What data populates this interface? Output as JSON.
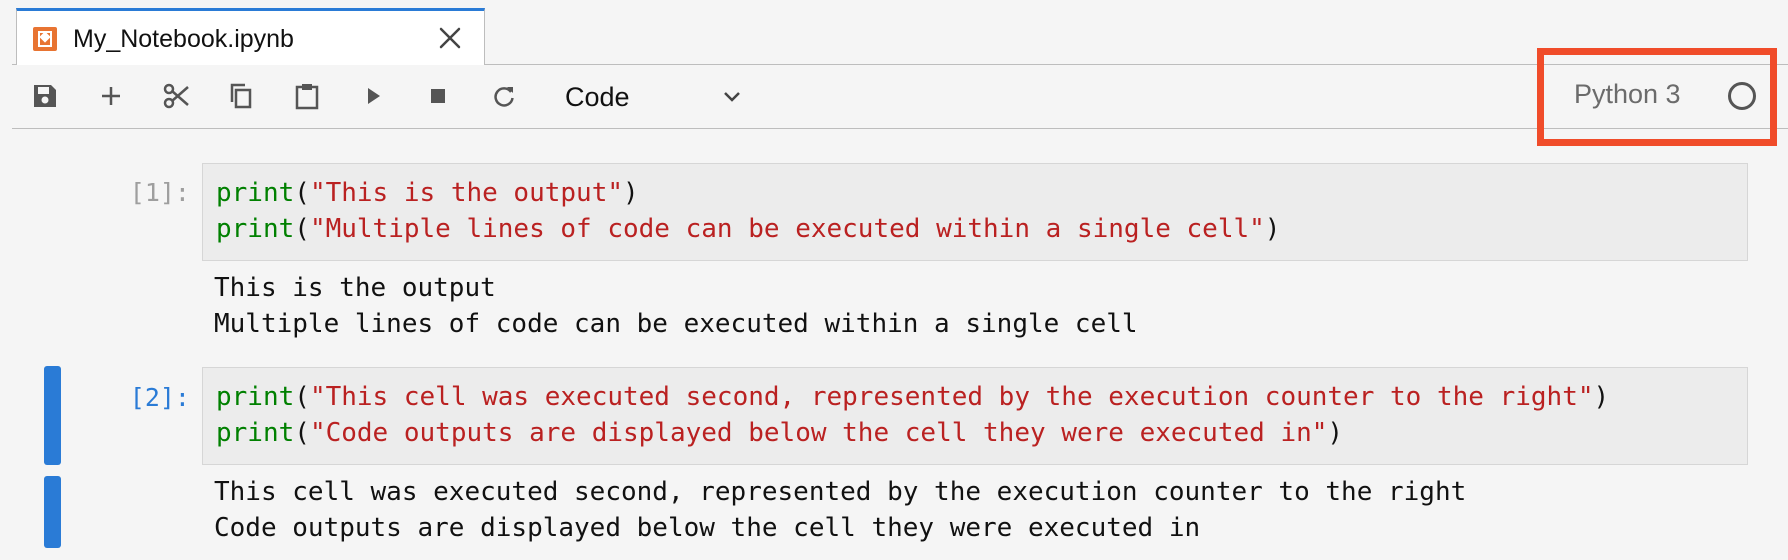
{
  "tab": {
    "title": "My_Notebook.ipynb"
  },
  "toolbar": {
    "cell_type": "Code",
    "buttons": [
      "save-icon",
      "add-icon",
      "cut-icon",
      "copy-icon",
      "paste-icon",
      "run-icon",
      "stop-icon",
      "restart-icon"
    ],
    "kernel_name": "Python 3"
  },
  "cells": [
    {
      "prompt": "[1]:",
      "code": [
        {
          "fn": "print",
          "open": "(",
          "str": "\"This is the output\"",
          "close": ")"
        },
        {
          "fn": "print",
          "open": "(",
          "str": "\"Multiple lines of code can be executed within a single cell\"",
          "close": ")"
        }
      ],
      "output": [
        "This is the output",
        "Multiple lines of code can be executed within a single cell"
      ]
    },
    {
      "prompt": "[2]:",
      "code": [
        {
          "fn": "print",
          "open": "(",
          "str": "\"This cell was executed second, represented by the execution counter to the right\"",
          "close": ")"
        },
        {
          "fn": "print",
          "open": "(",
          "str": "\"Code outputs are displayed below the cell they were executed in\"",
          "close": ")"
        }
      ],
      "output": [
        "This cell was executed second, represented by the execution counter to the right",
        "Code outputs are displayed below the cell they were executed in"
      ]
    }
  ],
  "colors": {
    "accent": "#2a7bd6",
    "highlight": "#f04c2a",
    "keyword": "#008000",
    "string": "#ba2121"
  }
}
